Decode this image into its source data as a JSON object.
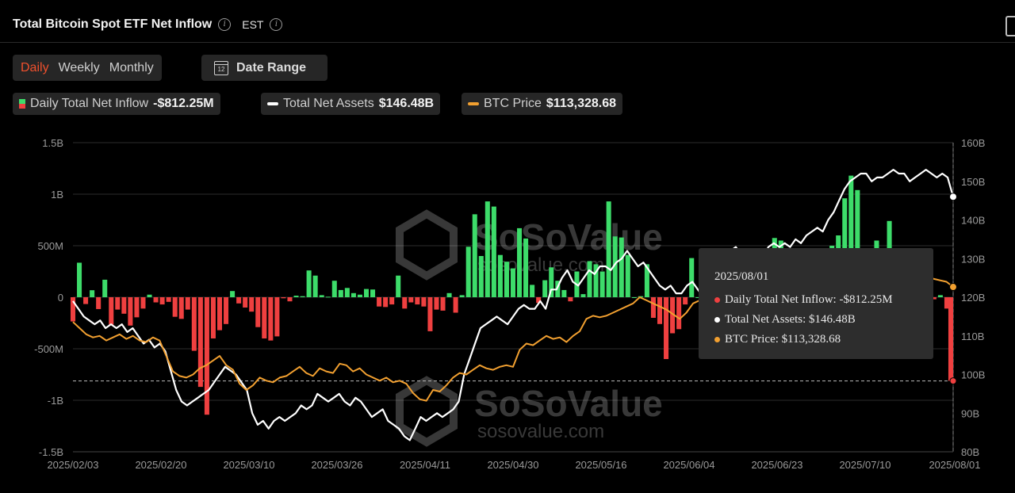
{
  "header": {
    "title": "Total Bitcoin Spot ETF Net Inflow",
    "timezone": "EST",
    "info_icon": "info-icon"
  },
  "tabs": [
    {
      "label": "Daily",
      "active": true
    },
    {
      "label": "Weekly",
      "active": false
    },
    {
      "label": "Monthly",
      "active": false
    }
  ],
  "date_range": {
    "label": "Date Range",
    "icon_text": "12"
  },
  "legend": {
    "inflow": {
      "name": "Daily Total Net Inflow",
      "value": "-$812.25M"
    },
    "assets": {
      "name": "Total Net Assets",
      "value": "$146.48B"
    },
    "price": {
      "name": "BTC Price",
      "value": "$113,328.68"
    }
  },
  "tooltip": {
    "date": "2025/08/01",
    "inflow": "Daily Total Net Inflow: -$812.25M",
    "assets": "Total Net Assets: $146.48B",
    "price": "BTC Price: $113,328.68"
  },
  "watermark": {
    "brand": "SoSoValue",
    "site": "sosovalue.com"
  },
  "colors": {
    "positive": "#3ddc6a",
    "negative": "#ef4040",
    "assets": "#ffffff",
    "price": "#f2a030",
    "accent": "#f0502d"
  },
  "chart_data": {
    "type": "bar",
    "left_axis": {
      "ticks": [
        "1.5B",
        "1B",
        "500M",
        "0",
        "-500M",
        "-1B",
        "-1.5B"
      ],
      "range_millions": [
        -1500,
        1500
      ]
    },
    "right_axis": {
      "ticks": [
        "160B",
        "150B",
        "140B",
        "130B",
        "120B",
        "110B",
        "100B",
        "90B",
        "80B"
      ],
      "range_billions": [
        80,
        160
      ]
    },
    "x_ticks": [
      "2025/02/03",
      "2025/02/20",
      "2025/03/10",
      "2025/03/26",
      "2025/04/11",
      "2025/04/30",
      "2025/05/16",
      "2025/06/04",
      "2025/06/23",
      "2025/07/10",
      "2025/08/01"
    ],
    "reference_line_millions": -812.25,
    "series": [
      {
        "name": "Daily Total Net Inflow",
        "kind": "bar",
        "unit": "M USD",
        "values": [
          -235,
          335,
          -66,
          68,
          -115,
          170,
          -265,
          -120,
          -160,
          -275,
          -195,
          -110,
          25,
          -50,
          -70,
          -45,
          -190,
          -210,
          -120,
          -520,
          -870,
          -1140,
          -400,
          -320,
          -260,
          60,
          -60,
          -100,
          -140,
          -290,
          -400,
          -420,
          -380,
          -10,
          -40,
          15,
          10,
          260,
          210,
          20,
          5,
          160,
          70,
          90,
          40,
          25,
          80,
          75,
          -90,
          -95,
          -70,
          210,
          -110,
          -50,
          -70,
          -90,
          -330,
          -120,
          -130,
          40,
          -150,
          20,
          490,
          805,
          400,
          930,
          880,
          410,
          345,
          280,
          670,
          570,
          120,
          -55,
          165,
          290,
          160,
          70,
          -40,
          250,
          30,
          350,
          320,
          250,
          930,
          590,
          580,
          410,
          0,
          10,
          320,
          -200,
          -260,
          -600,
          -350,
          -310,
          -70,
          380,
          0,
          360,
          90,
          -280,
          -130,
          -10,
          20,
          400,
          5,
          70,
          20,
          100,
          575,
          550,
          55,
          90,
          -20,
          25,
          120,
          -90,
          -45,
          500,
          600,
          960,
          1180,
          1040,
          90,
          200,
          550,
          330,
          740,
          90,
          170,
          -20,
          -20,
          15,
          -10,
          -20,
          20,
          -110,
          -812.25
        ]
      },
      {
        "name": "Total Net Assets",
        "kind": "line",
        "unit": "B USD",
        "values": [
          119,
          117,
          115,
          114,
          113,
          114,
          112,
          113,
          112,
          113,
          111,
          112,
          110,
          108,
          109,
          107,
          108,
          106,
          101,
          96,
          93,
          92,
          93,
          94,
          95,
          96,
          98,
          100,
          102,
          101,
          100,
          98,
          96,
          90,
          87,
          88,
          86,
          88,
          89,
          88,
          89,
          90,
          92,
          91,
          92,
          95,
          94,
          93,
          94,
          95,
          93,
          92,
          94,
          93,
          91,
          89,
          90,
          91,
          88,
          87,
          86,
          84,
          83,
          86,
          89,
          88,
          89,
          90,
          89,
          90,
          91,
          93,
          100,
          104,
          108,
          112,
          113,
          114,
          115,
          114,
          113,
          115,
          117,
          118,
          117,
          117,
          119,
          117,
          122,
          122,
          125,
          127,
          124,
          123,
          125,
          127,
          126,
          128,
          128,
          127,
          129,
          130,
          132,
          130,
          128,
          129,
          127,
          125,
          123,
          122,
          123,
          121,
          121,
          123,
          124,
          122,
          120,
          122,
          125,
          127,
          130,
          132,
          133,
          131,
          130,
          131,
          132,
          130,
          133,
          134,
          133,
          134,
          133,
          135,
          134,
          136,
          137,
          138,
          137,
          140,
          142,
          145,
          148,
          150,
          151,
          152,
          152,
          150,
          151,
          151,
          152,
          153,
          152,
          152,
          150,
          151,
          152,
          153,
          152,
          151,
          152,
          151,
          146
        ]
      },
      {
        "name": "BTC Price",
        "kind": "line",
        "unit": "USD",
        "values": [
          102000,
          100000,
          98000,
          97000,
          97500,
          96000,
          97000,
          98000,
          96500,
          97500,
          96000,
          95500,
          97000,
          96000,
          91000,
          86000,
          84500,
          84000,
          85000,
          87000,
          88000,
          89500,
          91000,
          88000,
          86500,
          82000,
          80000,
          81500,
          84000,
          83000,
          82500,
          84000,
          84500,
          86000,
          87500,
          85500,
          84500,
          87000,
          86000,
          85500,
          88500,
          88000,
          86000,
          87000,
          85000,
          84000,
          83000,
          84000,
          82500,
          83000,
          82000,
          79000,
          77000,
          76500,
          80000,
          79500,
          81500,
          84000,
          85500,
          85000,
          86500,
          88000,
          87000,
          86500,
          87500,
          88000,
          87500,
          93000,
          95000,
          94500,
          96000,
          97500,
          96500,
          97000,
          95500,
          97500,
          99000,
          103000,
          104000,
          103500,
          104000,
          105000,
          106000,
          107000,
          108000,
          110000,
          109000,
          108000,
          107000,
          106000,
          104500,
          103000,
          105000,
          108000,
          109000,
          107000,
          105500,
          104500,
          104000,
          106000,
          105000,
          103000,
          101000,
          105000,
          107000,
          108000,
          107000,
          106500,
          108000,
          109000,
          111500,
          117000,
          118000,
          121000,
          120000,
          118000,
          119000,
          117500,
          118500,
          119500,
          118000,
          117500,
          119000,
          118500,
          117500,
          116500,
          118500,
          117000,
          117500,
          116000,
          115500,
          115000,
          113328.68
        ]
      }
    ],
    "title": "",
    "xlabel": "",
    "ylabel": ""
  }
}
